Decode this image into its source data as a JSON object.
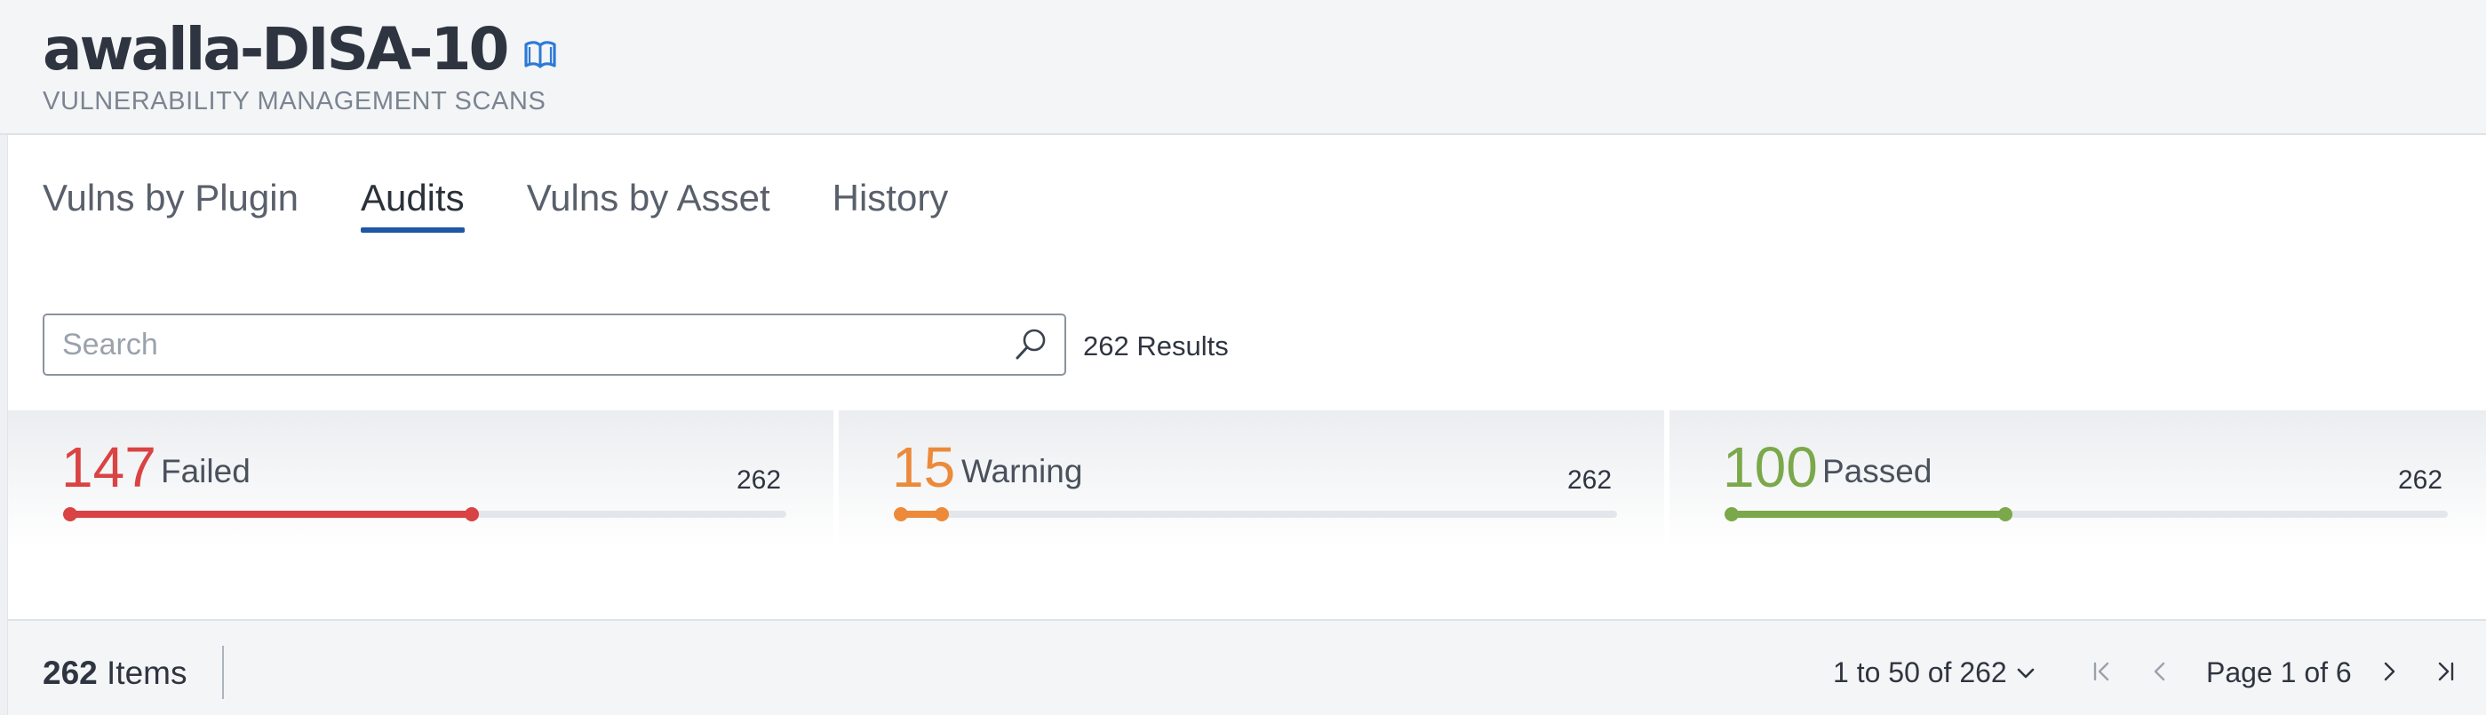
{
  "header": {
    "title": "awalla-DISA-10",
    "subtitle": "VULNERABILITY MANAGEMENT SCANS",
    "title_icon": "book-icon"
  },
  "tabs": [
    {
      "label": "Vulns by Plugin",
      "active": false
    },
    {
      "label": "Audits",
      "active": true
    },
    {
      "label": "Vulns by Asset",
      "active": false
    },
    {
      "label": "History",
      "active": false
    }
  ],
  "search": {
    "placeholder": "Search",
    "value": "",
    "icon": "search-icon",
    "results_label": "262 Results"
  },
  "summary": [
    {
      "count": "147",
      "label": "Failed",
      "total": "262",
      "fraction": 0.561,
      "color": "#d94343"
    },
    {
      "count": "15",
      "label": "Warning",
      "total": "262",
      "fraction": 0.057,
      "color": "#ec8a3a"
    },
    {
      "count": "100",
      "label": "Passed",
      "total": "262",
      "fraction": 0.382,
      "color": "#7ba84a"
    }
  ],
  "footer": {
    "items_number": "262",
    "items_label": "Items",
    "range_label": "1 to 50 of 262",
    "page_label": "Page 1 of 6",
    "icons": [
      "first-page-icon",
      "prev-page-icon",
      "next-page-icon",
      "last-page-icon"
    ]
  },
  "colors": {
    "accent": "#1f56a6",
    "failed": "#d94343",
    "warning": "#ec8a3a",
    "passed": "#7ba84a"
  }
}
